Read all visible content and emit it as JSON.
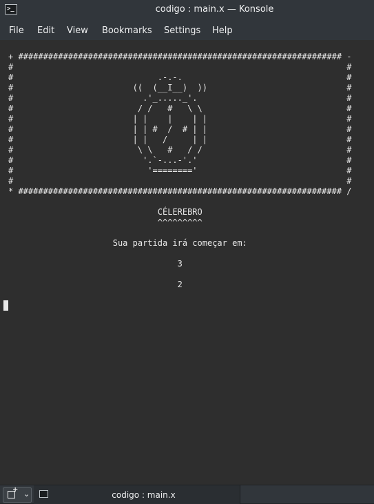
{
  "window": {
    "title": "codigo : main.x — Konsole",
    "icon": "terminal-icon"
  },
  "menu": [
    "File",
    "Edit",
    "View",
    "Bookmarks",
    "Settings",
    "Help"
  ],
  "terminal": {
    "lines": [
      "+ ################################################################# -",
      "#                                                                   #",
      "#                             .-.-.                                 #",
      "#                        ((  (__I__)  ))                            #",
      "#                          .'_....._'.                              #",
      "#                         / /   #   \\ \\                             #",
      "#                        | |    |    | |                            #",
      "#                        | | #  /  # | |                            #",
      "#                        | |   /     | |                            #",
      "#                         \\ \\   #   / /                             #",
      "#                          '.`-...-'.'                              #",
      "#                           '========'                              #",
      "#                                                                   #",
      "* ################################################################# /",
      "",
      "                              CÉLEREBRO",
      "                              ^^^^^^^^^",
      "",
      "                     Sua partida irá começar em:",
      "",
      "                                  3",
      "",
      "                                  2",
      ""
    ],
    "foreground": "#e8e8e8",
    "background": "#2e2e2e"
  },
  "tabs": {
    "new_tab_icon": "new-tab-icon",
    "items": [
      {
        "label": "codigo : main.x",
        "icon": "terminal-icon"
      }
    ]
  }
}
